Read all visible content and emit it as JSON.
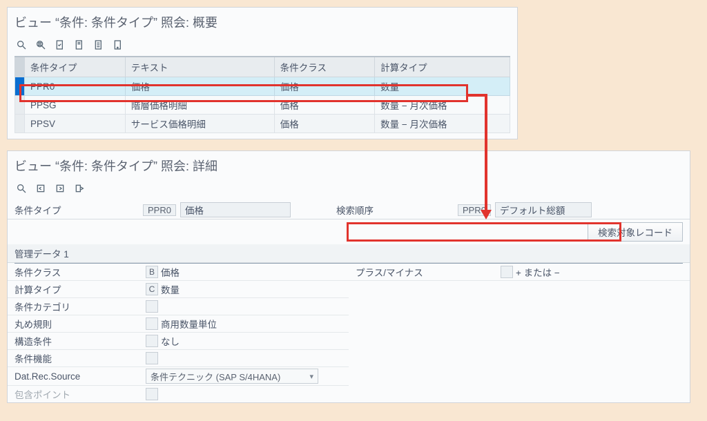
{
  "overview": {
    "title": "ビュー “条件: 条件タイプ” 照会: 概要",
    "columns": [
      "条件タイプ",
      "テキスト",
      "条件クラス",
      "計算タイプ"
    ],
    "rows": [
      {
        "code": "PPR0",
        "text": "価格",
        "class": "価格",
        "calc": "数量",
        "selected": true
      },
      {
        "code": "PPSG",
        "text": "階層価格明細",
        "class": "価格",
        "calc": "数量 − 月次価格",
        "selected": false
      },
      {
        "code": "PPSV",
        "text": "サービス価格明細",
        "class": "価格",
        "calc": "数量 − 月次価格",
        "selected": false
      }
    ]
  },
  "detail": {
    "title": "ビュー “条件: 条件タイプ” 照会: 詳細",
    "cond_type_label": "条件タイプ",
    "cond_type_code": "PPR0",
    "cond_type_text": "価格",
    "search_seq_label": "検索順序",
    "search_seq_code": "PPR0",
    "search_seq_text": "デフォルト総額",
    "records_btn": "検索対象レコード",
    "group_title": "管理データ 1",
    "fields": {
      "cond_class": {
        "label": "条件クラス",
        "code": "B",
        "text": "価格"
      },
      "calc_type": {
        "label": "計算タイプ",
        "code": "C",
        "text": "数量"
      },
      "cond_cat": {
        "label": "条件カテゴリ"
      },
      "round_rule": {
        "label": "丸め規則",
        "text": "商用数量単位"
      },
      "struct_cond": {
        "label": "構造条件",
        "text": "なし"
      },
      "cond_func": {
        "label": "条件機能"
      },
      "dat_src": {
        "label": "Dat.Rec.Source",
        "value": "条件テクニック (SAP S/4HANA)"
      },
      "incl_point": {
        "label": "包含ポイント"
      },
      "plus_minus": {
        "label": "プラス/マイナス",
        "text": "+ または −"
      }
    }
  }
}
